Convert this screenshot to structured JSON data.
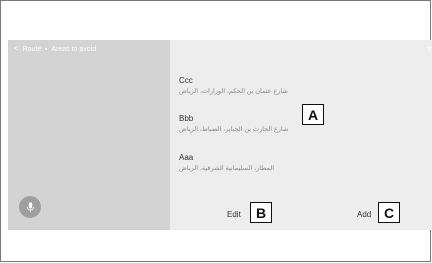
{
  "breadcrumb": {
    "back_glyph": "<",
    "items": [
      "Route",
      "Areas to avoid"
    ]
  },
  "areas": [
    {
      "name": "Ccc",
      "address": "شارع عثمان بن الحكم، الوزارات، الرياض"
    },
    {
      "name": "Bbb",
      "address": "شارع الحارث بن الجباير، الضباط، الرياض"
    },
    {
      "name": "Aaa",
      "address": "المطار، السليمانية الشرقية، الرياض"
    }
  ],
  "actions": {
    "edit_label": "Edit",
    "add_label": "Add"
  },
  "callouts": {
    "a": "A",
    "b": "B",
    "c": "C"
  },
  "colors": {
    "screen_background": "#ededed",
    "sidebar_background": "#d3d3d3",
    "mic_button": "#9f9f9f"
  },
  "icons": {
    "mic": "microphone-icon",
    "signal": "signal-icon",
    "back": "back-chevron-icon"
  }
}
